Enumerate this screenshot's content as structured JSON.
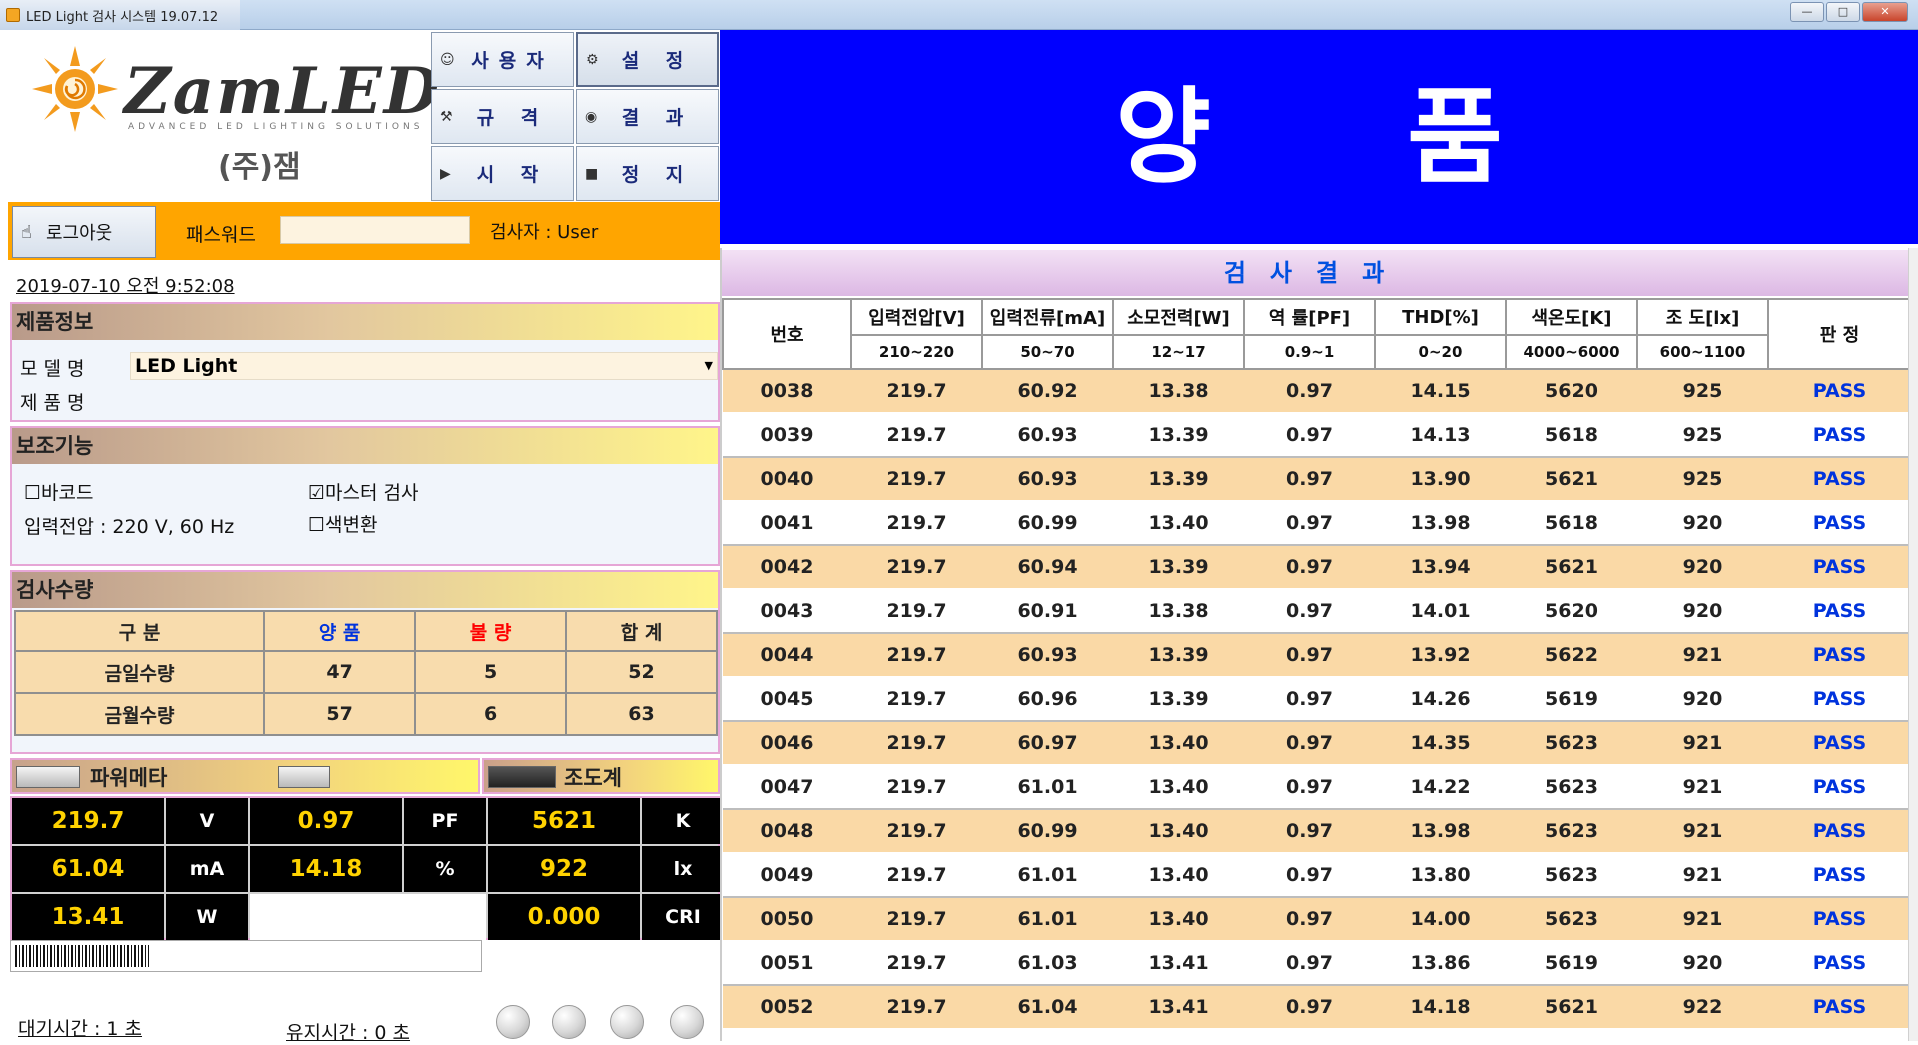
{
  "window": {
    "title": "LED Light 검사 시스템 19.07.12",
    "minimize": "—",
    "maximize": "□",
    "close": "✕"
  },
  "logo": {
    "brand": "ZamLED",
    "tagline": "ADVANCED LED LIGHTING SOLUTIONS",
    "company": "(주)잼"
  },
  "menu": {
    "user": "사용자",
    "settings": "설 정",
    "spec": "규 격",
    "result": "결 과",
    "start": "시 작",
    "stop": "정 지"
  },
  "login": {
    "logout": "로그아웃",
    "password_label": "패스워드",
    "password_value": "",
    "inspector": "검사자 : User"
  },
  "datetime": "2019-07-10 오전 9:52:08",
  "product": {
    "header": "제품정보",
    "model_label": "모 델 명",
    "model_value": "LED Light",
    "name_label": "제 품 명"
  },
  "aux": {
    "header": "보조기능",
    "barcode": "바코드",
    "barcode_checked": false,
    "master": "마스터 검사",
    "master_checked": true,
    "voltage": "입력전압 : 220 V,  60 Hz",
    "color_conv": "색변환",
    "color_checked": false
  },
  "counts": {
    "header": "검사수량",
    "cols": [
      "구  분",
      "양  품",
      "불  량",
      "합  계"
    ],
    "col_colors": [
      "#222222",
      "#0033dd",
      "#ff0000",
      "#222222"
    ],
    "rows": [
      [
        "금일수량",
        "47",
        "5",
        "52"
      ],
      [
        "금월수량",
        "57",
        "6",
        "63"
      ]
    ]
  },
  "meters": {
    "power_header": "파워메타",
    "lux_header": "조도계",
    "voltage": "219.7",
    "voltage_unit": "V",
    "pf": "0.97",
    "pf_unit": "PF",
    "cct": "5621",
    "cct_unit": "K",
    "current": "61.04",
    "current_unit": "mA",
    "thd": "14.18",
    "thd_unit": "%",
    "lux": "922",
    "lux_unit": "lx",
    "power": "13.41",
    "power_unit": "W",
    "cri": "0.000",
    "cri_unit": "CRI"
  },
  "status": {
    "wait": "대기시간 : 1 초",
    "hold": "유지시간 : 0 초"
  },
  "banner": {
    "text": "양 품",
    "color": "#0000ff"
  },
  "results": {
    "title": "검사결과",
    "headers": [
      "번호",
      "입력전압[V]",
      "입력전류[mA]",
      "소모전력[W]",
      "역   률[PF]",
      "THD[%]",
      "색온도[K]",
      "조    도[lx]",
      "판  정"
    ],
    "ranges": [
      "210~220",
      "50~70",
      "12~17",
      "0.9~1",
      "0~20",
      "4000~6000",
      "600~1100"
    ],
    "rows": [
      [
        "0038",
        "219.7",
        "60.92",
        "13.38",
        "0.97",
        "14.15",
        "5620",
        "925",
        "PASS"
      ],
      [
        "0039",
        "219.7",
        "60.93",
        "13.39",
        "0.97",
        "14.13",
        "5618",
        "925",
        "PASS"
      ],
      [
        "0040",
        "219.7",
        "60.93",
        "13.39",
        "0.97",
        "13.90",
        "5621",
        "925",
        "PASS"
      ],
      [
        "0041",
        "219.7",
        "60.99",
        "13.40",
        "0.97",
        "13.98",
        "5618",
        "920",
        "PASS"
      ],
      [
        "0042",
        "219.7",
        "60.94",
        "13.39",
        "0.97",
        "13.94",
        "5621",
        "920",
        "PASS"
      ],
      [
        "0043",
        "219.7",
        "60.91",
        "13.38",
        "0.97",
        "14.01",
        "5620",
        "920",
        "PASS"
      ],
      [
        "0044",
        "219.7",
        "60.93",
        "13.39",
        "0.97",
        "13.92",
        "5622",
        "921",
        "PASS"
      ],
      [
        "0045",
        "219.7",
        "60.96",
        "13.39",
        "0.97",
        "14.26",
        "5619",
        "920",
        "PASS"
      ],
      [
        "0046",
        "219.7",
        "60.97",
        "13.40",
        "0.97",
        "14.35",
        "5623",
        "921",
        "PASS"
      ],
      [
        "0047",
        "219.7",
        "61.01",
        "13.40",
        "0.97",
        "14.22",
        "5623",
        "921",
        "PASS"
      ],
      [
        "0048",
        "219.7",
        "60.99",
        "13.40",
        "0.97",
        "13.98",
        "5623",
        "921",
        "PASS"
      ],
      [
        "0049",
        "219.7",
        "61.01",
        "13.40",
        "0.97",
        "13.80",
        "5623",
        "921",
        "PASS"
      ],
      [
        "0050",
        "219.7",
        "61.01",
        "13.40",
        "0.97",
        "14.00",
        "5623",
        "921",
        "PASS"
      ],
      [
        "0051",
        "219.7",
        "61.03",
        "13.41",
        "0.97",
        "13.86",
        "5619",
        "920",
        "PASS"
      ],
      [
        "0052",
        "219.7",
        "61.04",
        "13.41",
        "0.97",
        "14.18",
        "5621",
        "922",
        "PASS"
      ]
    ]
  }
}
